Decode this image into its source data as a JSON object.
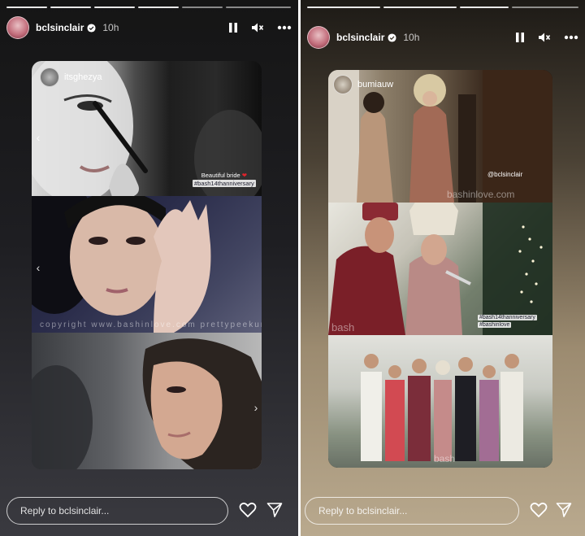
{
  "stories": [
    {
      "username": "bclsinclair",
      "time": "10h",
      "mention": "itsghezya",
      "sticker_line1": "Beautiful bride",
      "sticker_tag": "#bash14thanniversary",
      "watermark": "copyright  www.bashinlove.com  prettypeekures.com",
      "reply_placeholder": "Reply to bclsinclair..."
    },
    {
      "username": "bclsinclair",
      "time": "10h",
      "mention": "bumiauw",
      "credit": "@bclsinclair",
      "watermark1": "bashinlove.com",
      "sticker_tag": "#bash14thanniversary",
      "sticker_tag2": "#bashinlove",
      "watermark2": "bash",
      "watermark3": "bash",
      "reply_placeholder": "Reply to bclsinclair..."
    }
  ],
  "icons": [
    "verified-icon",
    "pause-icon",
    "mute-icon",
    "more-icon",
    "heart-icon",
    "send-icon",
    "chevron-left-icon",
    "chevron-right-icon"
  ]
}
